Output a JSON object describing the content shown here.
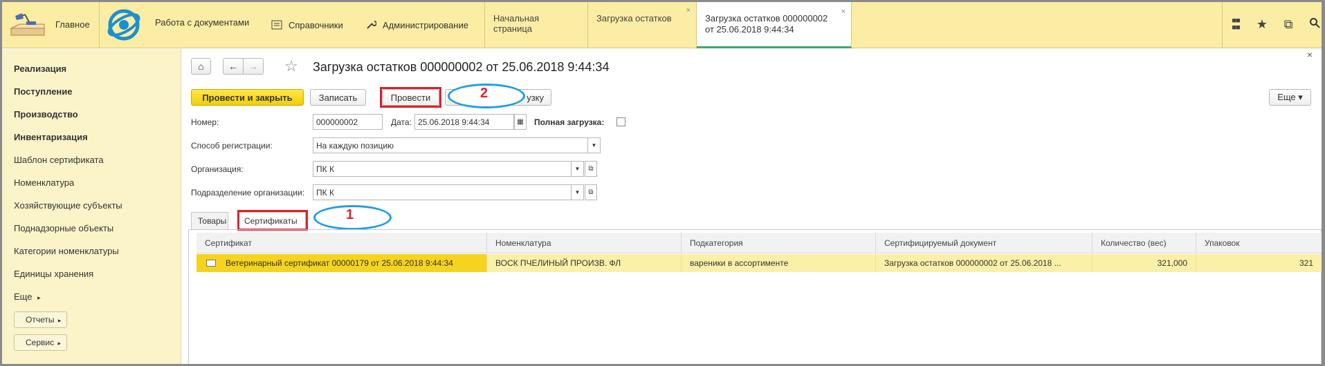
{
  "top": {
    "home_label": "Главное",
    "menu": [
      {
        "label": "Работа с документами",
        "icon": "none"
      },
      {
        "label": "Справочники",
        "icon": "list-icon"
      },
      {
        "label": "Администрирование",
        "icon": "wrench-icon"
      }
    ],
    "tabs": [
      {
        "label": "Начальная страница",
        "closable": false
      },
      {
        "label": "Загрузка остатков",
        "closable": true
      },
      {
        "label_line1": "Загрузка остатков 000000002",
        "label_line2": "от 25.06.2018 9:44:34",
        "closable": true,
        "active": true
      }
    ],
    "close_glyph": "×",
    "tools": [
      "apps-icon",
      "star-icon",
      "history-icon",
      "search-icon"
    ],
    "tool_glyphs": {
      "apps": "⋮⋮⋮",
      "star": "★",
      "history": "⧉",
      "search": "⚲"
    }
  },
  "sidebar": {
    "sections": [
      "Реализация",
      "Поступление",
      "Производство",
      "Инвентаризация"
    ],
    "items": [
      "Шаблон сертификата",
      "Номенклатура",
      "Хозяйствующие субъекты",
      "Поднадзорные объекты",
      "Категории номенклатуры",
      "Единицы хранения"
    ],
    "more_label": "Еще",
    "more_glyph": "▸",
    "buttons": [
      "Отчеты",
      "Сервис"
    ]
  },
  "doc": {
    "title": "Загрузка остатков 000000002 от 25.06.2018 9:44:34",
    "nav": {
      "home": "⌂",
      "back": "←",
      "forward": "→",
      "star": "☆"
    },
    "close_glyph": "×",
    "buttons": {
      "post_close": "Провести и закрыть",
      "save": "Записать",
      "post": "Провести",
      "hidden_partial": "узку",
      "more": "Еще ▾"
    },
    "fields": {
      "number_label": "Номер:",
      "number_value": "000000002",
      "date_label": "Дата:",
      "date_value": "25.06.2018  9:44:34",
      "full_load_label": "Полная загрузка:",
      "reg_label": "Способ регистрации:",
      "reg_value": "На каждую позицию",
      "org_label": "Организация:",
      "org_value": "ПК К",
      "subdiv_label": "Подразделение организации:",
      "subdiv_value": "ПК К"
    },
    "tabs": [
      "Товары",
      "Сертификаты"
    ],
    "annotations": {
      "one": "1",
      "two": "2"
    },
    "table": {
      "columns": [
        "Сертификат",
        "Номенклатура",
        "Подкатегория",
        "Сертифицируемый документ",
        "Количество (вес)",
        "Упаковок"
      ],
      "rows": [
        {
          "certificate": "Ветеринарный сертификат 00000179 от 25.06.2018 9:44:34",
          "nomenclature": "ВОСК ПЧЕЛИНЫЙ ПРОИЗВ. ФЛ",
          "subcategory": "вареники в ассортименте",
          "document": "Загрузка остатков 000000002 от 25.06.2018 ...",
          "quantity": "321,000",
          "packages": "321"
        }
      ]
    }
  },
  "colors": {
    "accent_yellow": "#f4cf00",
    "annotation_red": "#e0202a",
    "annotation_blue": "#1e9fe0",
    "active_tab_green": "#3aa86b"
  }
}
